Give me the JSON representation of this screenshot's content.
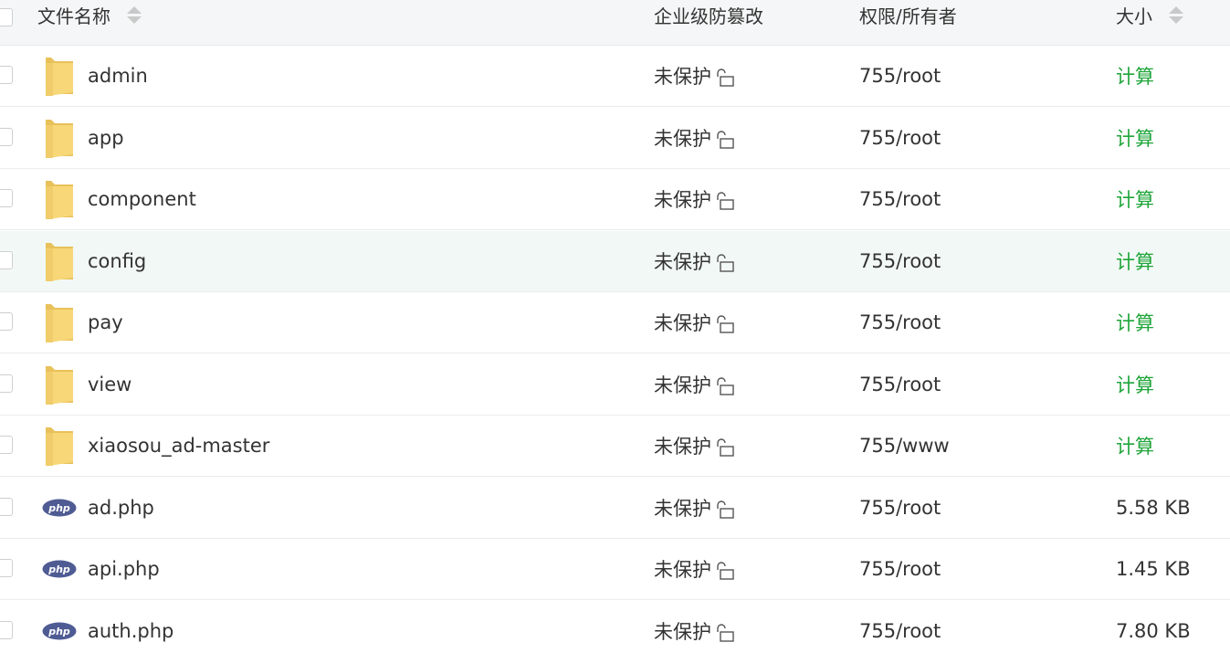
{
  "header": {
    "name_label": "文件名称",
    "protect_label": "企业级防篡改",
    "perm_label": "权限/所有者",
    "size_label": "大小"
  },
  "rows": [
    {
      "type": "folder",
      "icon": "folder-icon",
      "name": "admin",
      "protect": "未保护",
      "perm": "755/root",
      "size": "计算"
    },
    {
      "type": "folder",
      "icon": "folder-icon",
      "name": "app",
      "protect": "未保护",
      "perm": "755/root",
      "size": "计算"
    },
    {
      "type": "folder",
      "icon": "folder-icon",
      "name": "component",
      "protect": "未保护",
      "perm": "755/root",
      "size": "计算"
    },
    {
      "type": "folder",
      "icon": "folder-icon",
      "name": "config",
      "protect": "未保护",
      "perm": "755/root",
      "size": "计算"
    },
    {
      "type": "folder",
      "icon": "folder-icon",
      "name": "pay",
      "protect": "未保护",
      "perm": "755/root",
      "size": "计算"
    },
    {
      "type": "folder",
      "icon": "folder-icon",
      "name": "view",
      "protect": "未保护",
      "perm": "755/root",
      "size": "计算"
    },
    {
      "type": "folder",
      "icon": "folder-icon",
      "name": "xiaosou_ad-master",
      "protect": "未保护",
      "perm": "755/www",
      "size": "计算"
    },
    {
      "type": "php",
      "icon": "php-file-icon",
      "name": "ad.php",
      "protect": "未保护",
      "perm": "755/root",
      "size": "5.58 KB"
    },
    {
      "type": "php",
      "icon": "php-file-icon",
      "name": "api.php",
      "protect": "未保护",
      "perm": "755/root",
      "size": "1.45 KB"
    },
    {
      "type": "php",
      "icon": "php-file-icon",
      "name": "auth.php",
      "protect": "未保护",
      "perm": "755/root",
      "size": "7.80 KB"
    }
  ],
  "colors": {
    "calc_link": "#20a53a",
    "header_bg": "#f5f6f7",
    "hover_row_bg": "#f2f8f5"
  }
}
